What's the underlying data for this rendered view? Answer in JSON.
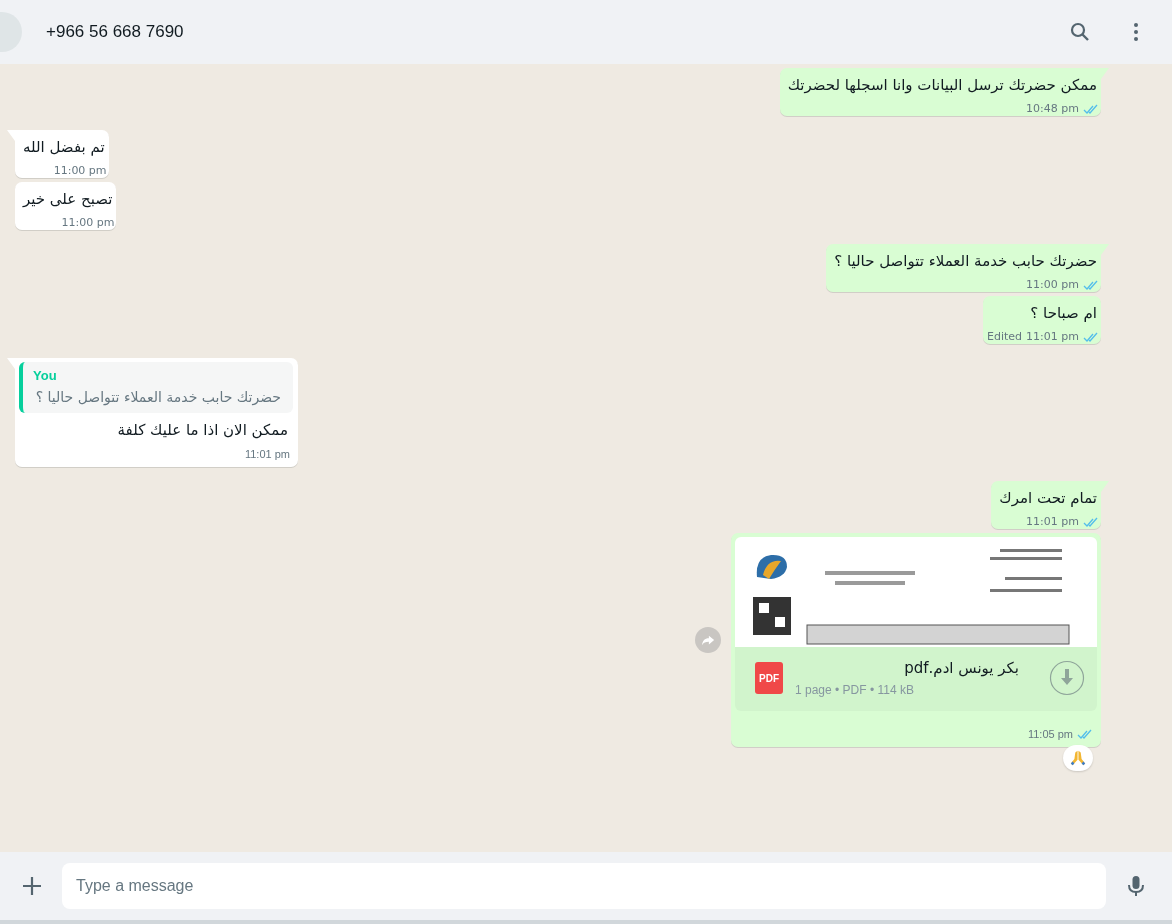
{
  "header": {
    "title": "+966 56 668 7690"
  },
  "messages": [
    {
      "kind": "text",
      "outgoing": true,
      "group_start": true,
      "text": "ممكن حضرتك ترسل البيانات وانا اسجلها لحضرتك",
      "time": "10:48 pm",
      "read": true
    },
    {
      "kind": "text",
      "outgoing": false,
      "group_start": true,
      "text": "تم بفضل الله",
      "time": "11:00 pm"
    },
    {
      "kind": "text",
      "outgoing": false,
      "group_start": false,
      "text": "تصبح على خير",
      "time": "11:00 pm"
    },
    {
      "kind": "text",
      "outgoing": true,
      "group_start": true,
      "text": "حضرتك حابب خدمة العملاء تتواصل حاليا ؟",
      "time": "11:00 pm",
      "read": true
    },
    {
      "kind": "text",
      "outgoing": true,
      "group_start": false,
      "text": "ام صباحا ؟",
      "edited": "Edited",
      "time": "11:01 pm",
      "read": true
    },
    {
      "kind": "reply",
      "outgoing": false,
      "group_start": true,
      "quote_author": "You",
      "quote_text": "حضرتك حابب خدمة العملاء تتواصل حاليا ؟",
      "text": "ممكن الان اذا ما عليك كلفة",
      "time": "11:01 pm"
    },
    {
      "kind": "text",
      "outgoing": true,
      "group_start": true,
      "text": "تمام تحت امرك",
      "time": "11:01 pm",
      "read": true
    },
    {
      "kind": "document",
      "outgoing": true,
      "group_start": false,
      "file_name": "بكر يونس ادم.pdf",
      "file_badge": "PDF",
      "file_meta": "1 page • PDF • 114 kB",
      "time": "11:05 pm",
      "read": true,
      "forward_button": true,
      "reaction": true
    }
  ],
  "composer": {
    "placeholder": "Type a message"
  }
}
